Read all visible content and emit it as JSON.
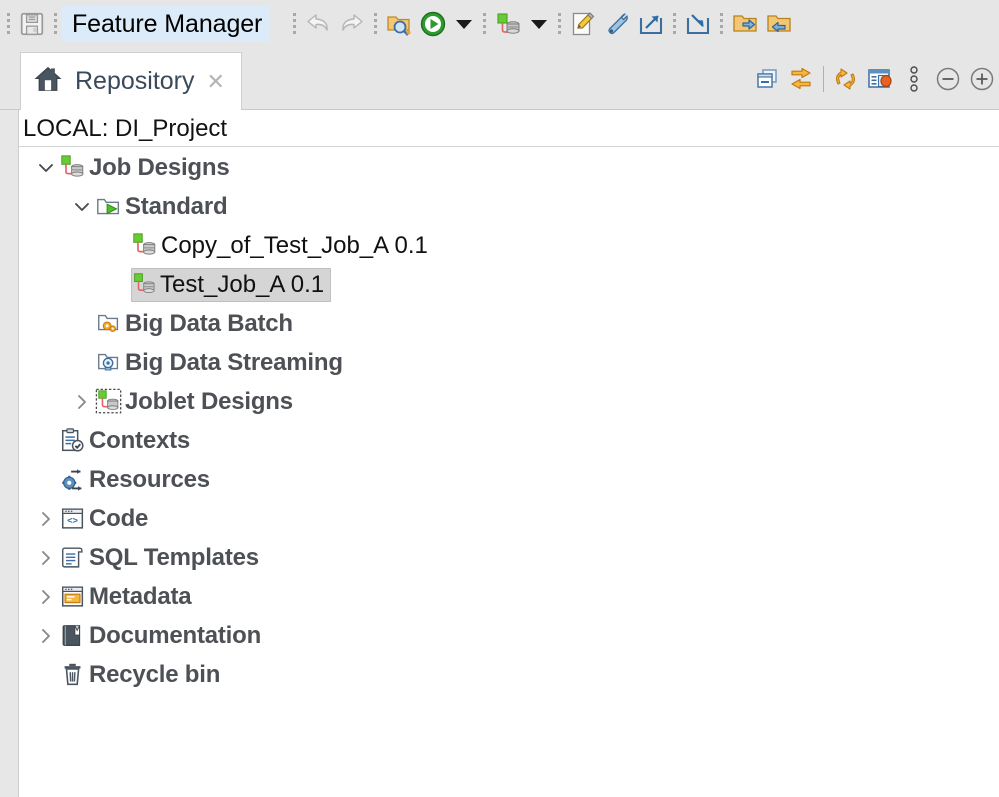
{
  "toolbar": {
    "save_icon": "save-floppy-icon",
    "feature_manager_value": "Feature Manager",
    "undo_icon": "undo-arrow-icon",
    "redo_icon": "redo-arrow-icon",
    "find_icon": "find-folder-icon",
    "run_icon": "run-green-play-icon",
    "run_dropdown_icon": "chevron-down-icon",
    "job_icon": "job-designs-icon",
    "job_dropdown_icon": "chevron-down-icon",
    "edit_icon": "edit-pencil-icon",
    "wrench_icon": "wrench-screwdriver-icon",
    "export_icon": "export-arrow-icon",
    "import_icon": "import-arrow-icon",
    "export_folder_icon": "export-items-folder-icon",
    "import_folder_icon": "import-items-folder-icon"
  },
  "tab": {
    "home_icon": "home-icon",
    "label": "Repository",
    "close_icon": "close-x-icon"
  },
  "view_tools": [
    {
      "name": "minimize-view-icon",
      "title": "Minimize"
    },
    {
      "name": "link-sync-icon",
      "title": "Link with editor"
    },
    {
      "name": "refresh-icon",
      "title": "Refresh"
    },
    {
      "name": "filter-view-icon",
      "title": "Filter"
    },
    {
      "name": "view-menu-icon",
      "title": "View Menu"
    },
    {
      "name": "collapse-all-icon",
      "title": "Collapse All"
    },
    {
      "name": "expand-all-icon",
      "title": "Expand All"
    }
  ],
  "project": {
    "header": "LOCAL: DI_Project"
  },
  "colors": {
    "toolbar_bg": "#e6e6e6",
    "panel_bg": "#ffffff",
    "selection_bg": "#d5d5d5",
    "field_highlight": "#dcebf9",
    "label_text": "#4d5156",
    "tab_text": "#3b4a5a",
    "green_accent": "#5cb531",
    "orange_accent": "#f0a32a",
    "blue_accent": "#2e6ca4"
  },
  "tree": [
    {
      "id": "job-designs",
      "label": "Job Designs",
      "indent": 0,
      "twisty": "expanded",
      "icon": "job-designs-icon",
      "bold": true,
      "selected": false
    },
    {
      "id": "standard",
      "label": "Standard",
      "indent": 1,
      "twisty": "expanded",
      "icon": "standard-folder-icon",
      "bold": true,
      "selected": false
    },
    {
      "id": "copy-of-test-job-a",
      "label": "Copy_of_Test_Job_A 0.1",
      "indent": 2,
      "twisty": "none",
      "icon": "job-item-icon",
      "bold": false,
      "selected": false
    },
    {
      "id": "test-job-a",
      "label": "Test_Job_A 0.1",
      "indent": 2,
      "twisty": "none",
      "icon": "job-item-icon",
      "bold": false,
      "selected": true
    },
    {
      "id": "big-data-batch",
      "label": "Big Data Batch",
      "indent": 1,
      "twisty": "none",
      "icon": "big-data-batch-icon",
      "bold": true,
      "selected": false
    },
    {
      "id": "big-data-streaming",
      "label": "Big Data Streaming",
      "indent": 1,
      "twisty": "none",
      "icon": "big-data-streaming-icon",
      "bold": true,
      "selected": false
    },
    {
      "id": "joblet-designs",
      "label": "Joblet Designs",
      "indent": 1,
      "twisty": "collapsed",
      "icon": "joblet-designs-icon",
      "bold": true,
      "selected": false
    },
    {
      "id": "contexts",
      "label": "Contexts",
      "indent": 0,
      "twisty": "none",
      "icon": "contexts-icon",
      "bold": true,
      "selected": false
    },
    {
      "id": "resources",
      "label": "Resources",
      "indent": 0,
      "twisty": "none",
      "icon": "resources-icon",
      "bold": true,
      "selected": false
    },
    {
      "id": "code",
      "label": "Code",
      "indent": 0,
      "twisty": "collapsed",
      "icon": "code-icon",
      "bold": true,
      "selected": false
    },
    {
      "id": "sql-templates",
      "label": "SQL Templates",
      "indent": 0,
      "twisty": "collapsed",
      "icon": "sql-templates-icon",
      "bold": true,
      "selected": false
    },
    {
      "id": "metadata",
      "label": "Metadata",
      "indent": 0,
      "twisty": "collapsed",
      "icon": "metadata-icon",
      "bold": true,
      "selected": false
    },
    {
      "id": "documentation",
      "label": "Documentation",
      "indent": 0,
      "twisty": "collapsed",
      "icon": "documentation-icon",
      "bold": true,
      "selected": false
    },
    {
      "id": "recycle-bin",
      "label": "Recycle bin",
      "indent": 0,
      "twisty": "none",
      "icon": "recycle-bin-icon",
      "bold": true,
      "selected": false
    }
  ]
}
